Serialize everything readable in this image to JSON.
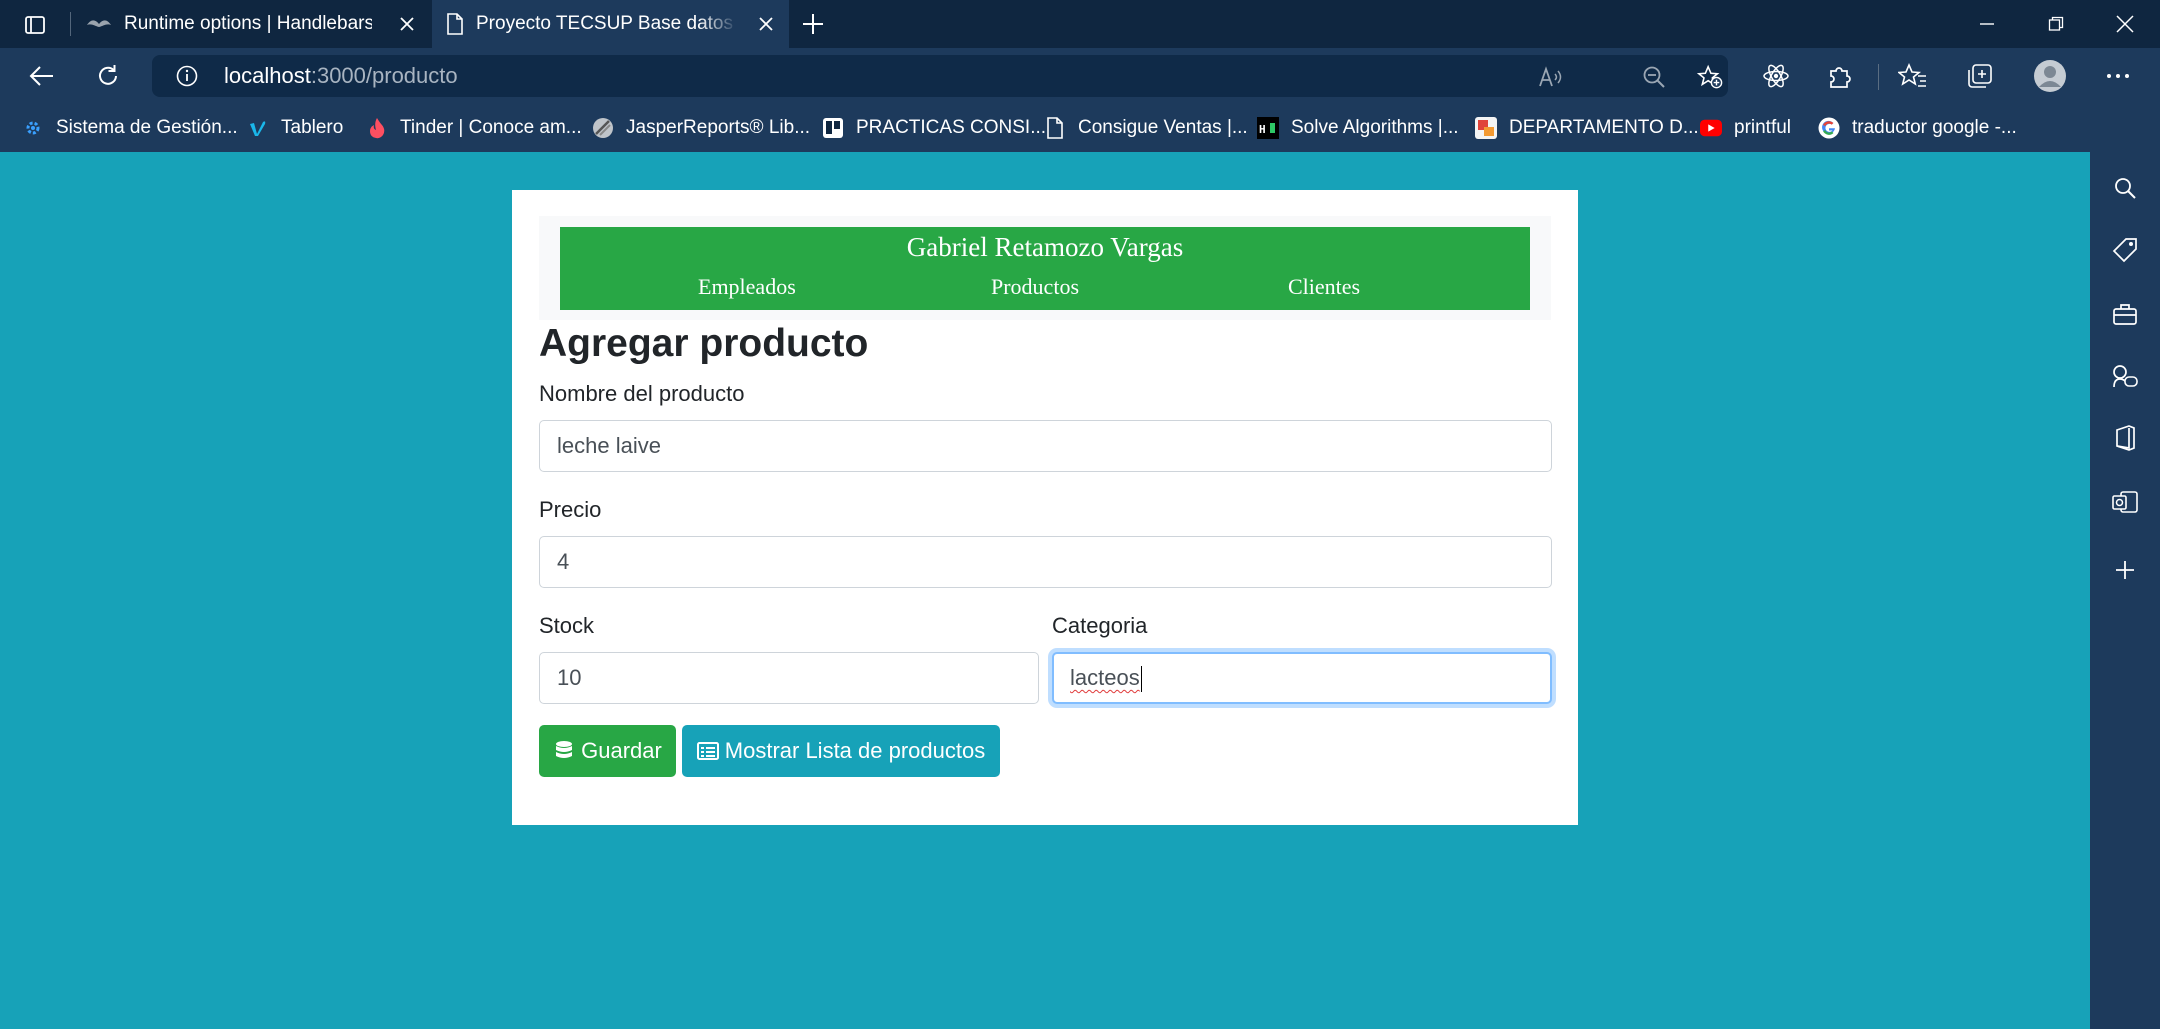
{
  "browser": {
    "tabs": [
      {
        "title": "Runtime options | Handlebars",
        "active": false
      },
      {
        "title": "Proyecto TECSUP Base datos avanzado",
        "active": true
      }
    ],
    "address": {
      "host": "localhost",
      "path": ":3000/producto"
    },
    "bookmarks": [
      {
        "label": "Sistema de Gestión...",
        "icon": "gear-favicon"
      },
      {
        "label": "Tablero",
        "icon": "vimeo-favicon"
      },
      {
        "label": "Tinder | Conoce am...",
        "icon": "tinder-flame-favicon"
      },
      {
        "label": "JasperReports® Lib...",
        "icon": "jasper-favicon"
      },
      {
        "label": "PRACTICAS CONSI...",
        "icon": "trello-favicon"
      },
      {
        "label": "Consigue Ventas |...",
        "icon": "page-icon"
      },
      {
        "label": "Solve Algorithms |...",
        "icon": "hackerrank-favicon"
      },
      {
        "label": "DEPARTAMENTO D...",
        "icon": "department-favicon"
      },
      {
        "label": "printful",
        "icon": "youtube-favicon"
      },
      {
        "label": "traductor google -...",
        "icon": "google-favicon"
      }
    ]
  },
  "page": {
    "header": {
      "author": "Gabriel Retamozo Vargas",
      "menu": [
        "Empleados",
        "Productos",
        "Clientes"
      ]
    },
    "title": "Agregar producto",
    "form": {
      "nombre": {
        "label": "Nombre del producto",
        "value": "leche laive"
      },
      "precio": {
        "label": "Precio",
        "value": "4"
      },
      "stock": {
        "label": "Stock",
        "value": "10"
      },
      "categoria": {
        "label": "Categoria",
        "value": "lacteos"
      }
    },
    "buttons": {
      "save": "Guardar",
      "list": "Mostrar Lista de productos"
    }
  },
  "colors": {
    "page_background": "#17a2b8",
    "header_green": "#28a745",
    "browser_dark": "#0f2640",
    "browser_toolbar": "#1d3a5c"
  }
}
